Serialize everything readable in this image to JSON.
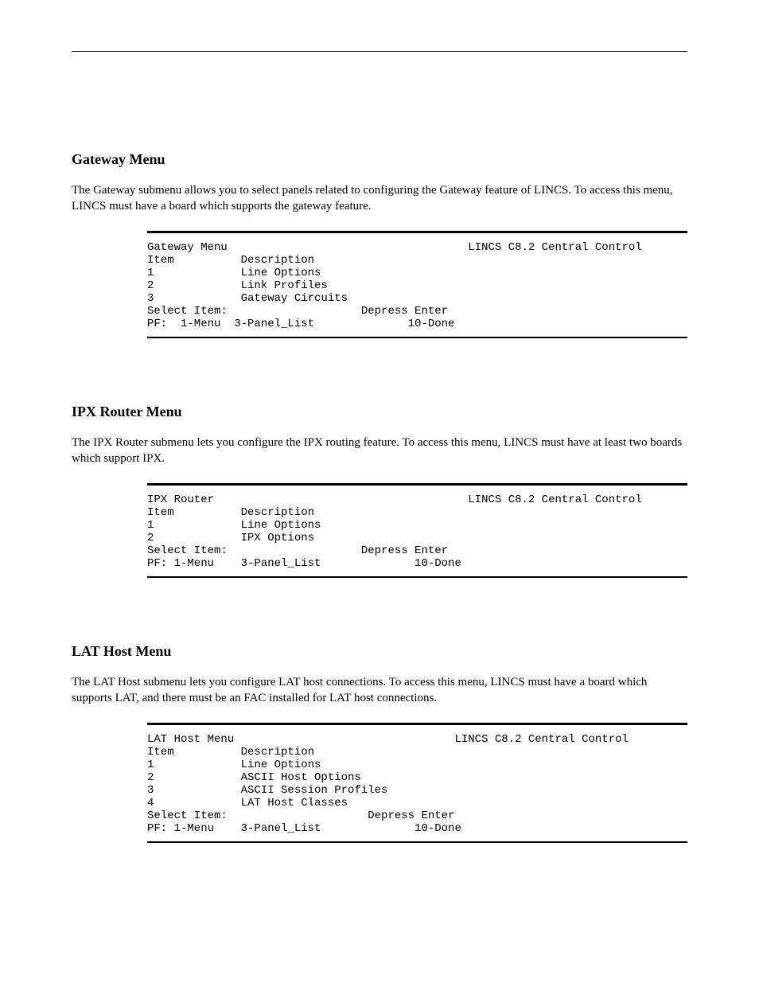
{
  "panels": [
    {
      "title": "Gateway Menu",
      "intro": "The Gateway submenu allows you to select panels related to configuring the Gateway feature of LINCS. To access this menu, LINCS must have a board which supports the gateway feature.",
      "header_left": "Gateway Menu",
      "header_right": "LINCS C8.2 Central Control",
      "columns": "Item          Description",
      "rows": [
        "1             Line Options",
        "2             Link Profiles",
        "3             Gateway Circuits"
      ],
      "prompt": "Select Item:                    Depress Enter",
      "pf": "PF:  1-Menu  3-Panel_List              10-Done"
    },
    {
      "title": "IPX Router Menu",
      "intro": "The IPX Router submenu lets you configure the IPX routing feature. To access this menu, LINCS must have at least two boards which support IPX.",
      "header_left": "IPX Router",
      "header_right": "LINCS C8.2 Central Control",
      "columns": "Item          Description",
      "rows": [
        "1             Line Options",
        "2             IPX Options"
      ],
      "prompt": "Select Item:                    Depress Enter",
      "pf": "PF: 1-Menu    3-Panel_List              10-Done"
    },
    {
      "title": "LAT Host Menu",
      "intro": "The LAT Host submenu lets you configure LAT host connections. To access this menu, LINCS must have a board which supports LAT, and there must be an FAC installed for LAT host connections.",
      "header_left": "LAT Host Menu",
      "header_right": "LINCS C8.2 Central Control",
      "columns": "Item          Description",
      "rows": [
        "1             Line Options",
        "2             ASCII Host Options",
        "3             ASCII Session Profiles",
        "4             LAT Host Classes"
      ],
      "prompt": "Select Item:                     Depress Enter",
      "pf": "PF: 1-Menu    3-Panel_List              10-Done"
    }
  ]
}
